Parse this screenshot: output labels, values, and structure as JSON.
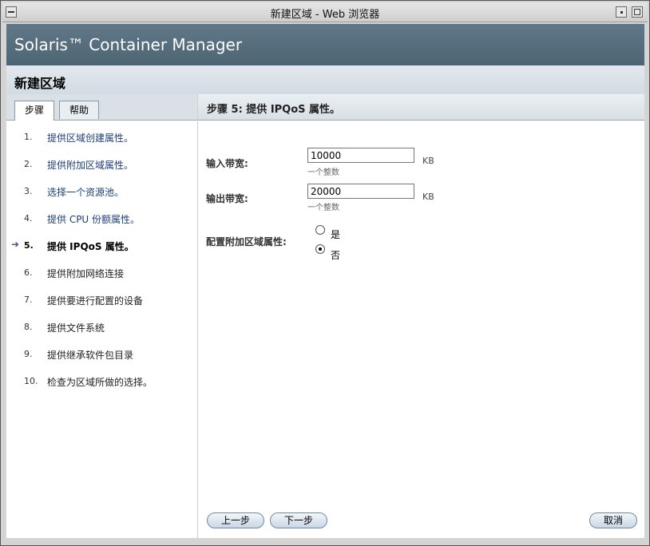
{
  "window": {
    "title": "新建区域 - Web 浏览器"
  },
  "masthead": {
    "app_title": "Solaris™ Container Manager"
  },
  "page": {
    "title": "新建区域"
  },
  "tabs": {
    "steps": "步骤",
    "help": "帮助"
  },
  "steps": [
    {
      "num": "1.",
      "label": "提供区域创建属性。"
    },
    {
      "num": "2.",
      "label": "提供附加区域属性。"
    },
    {
      "num": "3.",
      "label": "选择一个资源池。"
    },
    {
      "num": "4.",
      "label": "提供 CPU 份额属性。"
    },
    {
      "num": "5.",
      "label": "提供 IPQoS 属性。"
    },
    {
      "num": "6.",
      "label": "提供附加网络连接"
    },
    {
      "num": "7.",
      "label": "提供要进行配置的设备"
    },
    {
      "num": "8.",
      "label": "提供文件系统"
    },
    {
      "num": "9.",
      "label": "提供继承软件包目录"
    },
    {
      "num": "10.",
      "label": "检查为区域所做的选择。"
    }
  ],
  "current_step": {
    "arrow": "➜"
  },
  "step_header": {
    "title": "步骤 5: 提供 IPQoS 属性。"
  },
  "form": {
    "input_bandwidth": {
      "label": "输入带宽:",
      "value": "10000",
      "unit": "KB",
      "help": "一个整数"
    },
    "output_bandwidth": {
      "label": "输出带宽:",
      "value": "20000",
      "unit": "KB",
      "help": "一个整数"
    },
    "config_extra": {
      "label": "配置附加区域属性:",
      "options": [
        "是",
        "否"
      ],
      "selected": "否"
    }
  },
  "buttons": {
    "previous": "上一步",
    "next": "下一步",
    "cancel": "取消"
  },
  "colors": {
    "masthead": "#566e7e",
    "link": "#1d3e7a",
    "button_border": "#6d8aa8"
  }
}
